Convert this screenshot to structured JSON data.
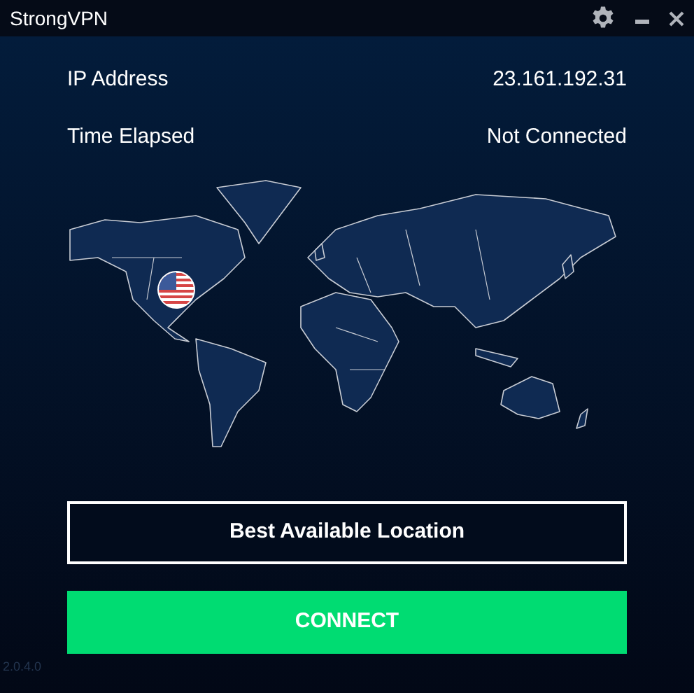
{
  "window": {
    "title": "StrongVPN"
  },
  "info": [
    {
      "label": "IP Address",
      "value": "23.161.192.31"
    },
    {
      "label": "Time Elapsed",
      "value": "Not Connected"
    }
  ],
  "location_button": "Best Available Location",
  "connect_button": "CONNECT",
  "version": "2.0.4.0"
}
